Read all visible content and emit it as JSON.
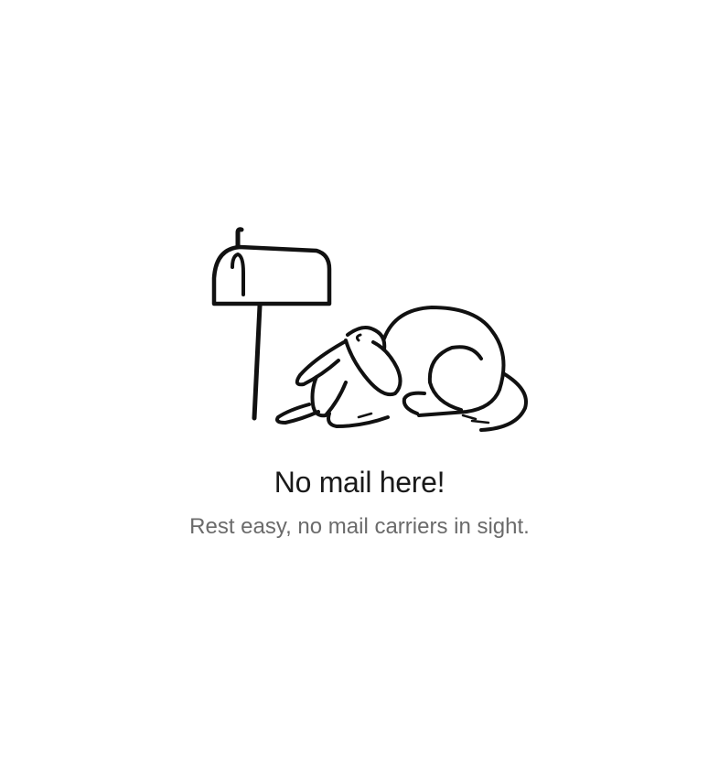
{
  "empty_state": {
    "illustration_icon": "mailbox-with-sleeping-dog-icon",
    "title": "No mail here!",
    "subtitle": "Rest easy, no mail carriers in sight."
  },
  "colors": {
    "background": "#ffffff",
    "title": "#1a1a1a",
    "subtitle": "#6b6b6b",
    "illustration_stroke": "#111111"
  }
}
